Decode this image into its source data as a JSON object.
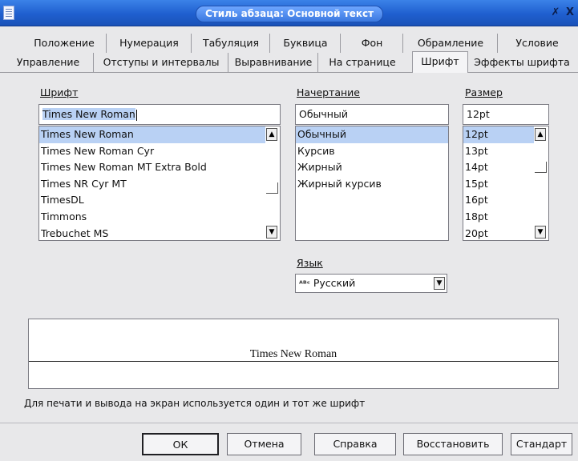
{
  "window": {
    "title": "Стиль абзаца: Основной текст",
    "pin_glyph": "✗",
    "close_glyph": "X"
  },
  "tabs": {
    "row1": [
      "Положение",
      "Нумерация",
      "Табуляция",
      "Буквица",
      "Фон",
      "Обрамление",
      "Условие"
    ],
    "row2": [
      "Управление",
      "Отступы и интервалы",
      "Выравнивание",
      "На странице",
      "Шрифт",
      "Эффекты шрифта"
    ],
    "active": "Шрифт"
  },
  "font": {
    "label": "Шрифт",
    "value": "Times New Roman",
    "items": [
      "Times New Roman",
      "Times New Roman Cyr",
      "Times New Roman MT Extra Bold",
      "Times NR Cyr MT",
      "TimesDL",
      "Timmons",
      "Trebuchet MS"
    ],
    "selected_index": 0
  },
  "style": {
    "label": "Начертание",
    "value": "Обычный",
    "items": [
      "Обычный",
      "Курсив",
      "Жирный",
      "Жирный курсив"
    ],
    "selected_index": 0
  },
  "size": {
    "label": "Размер",
    "value": "12pt",
    "items": [
      "12pt",
      "13pt",
      "14pt",
      "15pt",
      "16pt",
      "18pt",
      "20pt"
    ],
    "selected_index": 0
  },
  "language": {
    "label": "Язык",
    "icon_text": "ᴬᴮᶜ",
    "value": "Русский"
  },
  "preview": {
    "text": "Times New Roman"
  },
  "info_text": "Для печати и вывода на экран используется один и тот же шрифт",
  "buttons": {
    "ok": "ОК",
    "cancel": "Отмена",
    "help": "Справка",
    "reset": "Восстановить",
    "standard": "Стандарт"
  },
  "icons": {
    "scroll_up": "▲",
    "scroll_down": "▼",
    "dropdown": "▼"
  }
}
